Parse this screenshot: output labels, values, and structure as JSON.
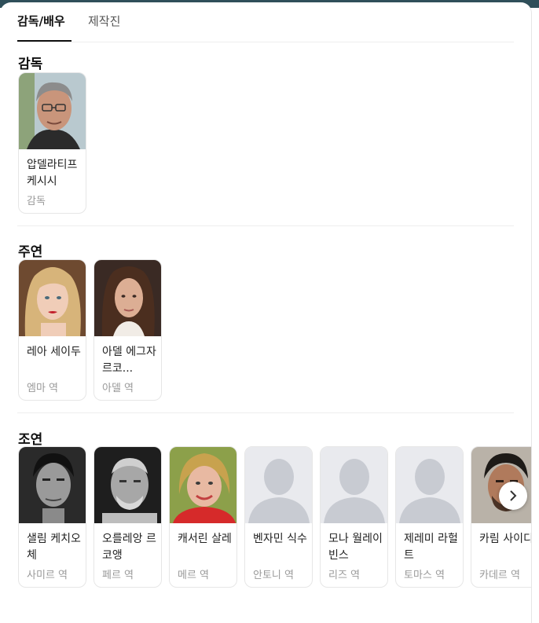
{
  "tabs": [
    {
      "label": "감독/배우"
    },
    {
      "label": "제작진"
    }
  ],
  "sections": {
    "director": {
      "title": "감독",
      "people": [
        {
          "name": "압델라티프 케시시",
          "role": "감독"
        }
      ]
    },
    "lead": {
      "title": "주연",
      "people": [
        {
          "name": "레아 세이두",
          "role": "엠마 역"
        },
        {
          "name": "아델 에그자르코...",
          "role": "아델 역"
        }
      ]
    },
    "supporting": {
      "title": "조연",
      "people": [
        {
          "name": "샐림 케치오체",
          "role": "사미르 역"
        },
        {
          "name": "오를레앙 르코앵",
          "role": "페르 역"
        },
        {
          "name": "캐서린 살레",
          "role": "메르 역"
        },
        {
          "name": "벤자민 식수",
          "role": "안토니 역"
        },
        {
          "name": "모나 월레이빈스",
          "role": "리즈 역"
        },
        {
          "name": "제레미 라헐트",
          "role": "토마스 역"
        },
        {
          "name": "카림 사이디",
          "role": "카데르 역"
        }
      ]
    }
  },
  "colors": {
    "accent": "#111111",
    "placeholder_bg": "#e9eaee",
    "placeholder_fg": "#c8cbd2"
  }
}
